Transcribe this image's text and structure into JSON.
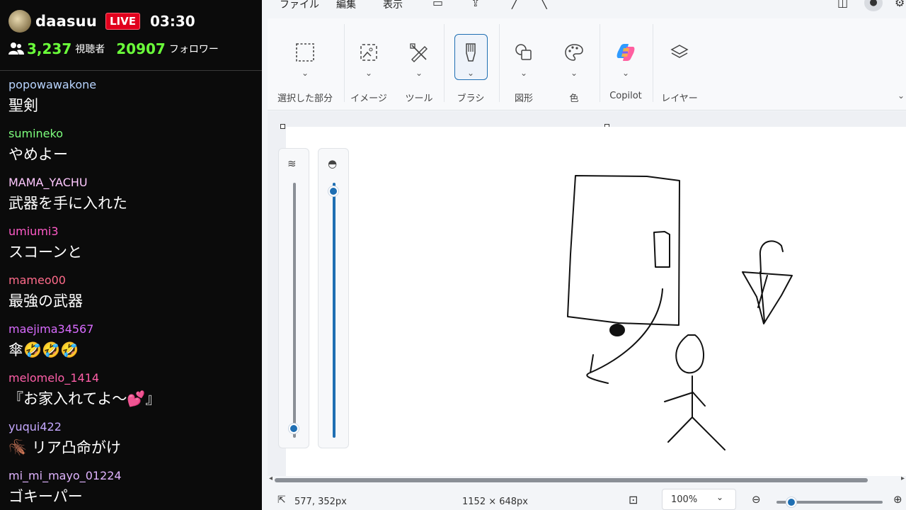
{
  "stream": {
    "streamer_name": "daasuu",
    "live_badge": "LIVE",
    "elapsed_time": "03:30",
    "viewers_count": "3,237",
    "viewers_label": "視聴者",
    "followers_count": "20907",
    "followers_label": "フォロワー"
  },
  "chat": {
    "messages": [
      {
        "user": "popowawakone",
        "user_color": "#b8d4ff",
        "text": "聖剣"
      },
      {
        "user": "sumineko",
        "user_color": "#7dff7d",
        "text": "やめよー"
      },
      {
        "user": "MAMA_YACHU",
        "user_color": "#ffc8ff",
        "text": "武器を手に入れた"
      },
      {
        "user": "umiumi3",
        "user_color": "#ff5bc8",
        "text": "スコーンと"
      },
      {
        "user": "mameo00",
        "user_color": "#ff6b8a",
        "text": "最強の武器"
      },
      {
        "user": "maejima34567",
        "user_color": "#d96bff",
        "text": "傘🤣🤣🤣"
      },
      {
        "user": "melomelo_1414",
        "user_color": "#ff5fa8",
        "text": "『お家入れてよ〜💕』"
      },
      {
        "user": "yuqui422",
        "user_color": "#c5a8ff",
        "text": "🪳 リア凸命がけ"
      },
      {
        "user": "mi_mi_mayo_01224",
        "user_color": "#e0b4ff",
        "text": "ゴキーパー"
      }
    ]
  },
  "paint": {
    "menu": {
      "file": "ファイル",
      "edit": "編集",
      "view": "表示"
    },
    "ribbon": {
      "selection": "選択した部分",
      "image": "イメージ",
      "tools": "ツール",
      "brush": "ブラシ",
      "shapes": "図形",
      "color": "色",
      "copilot": "Copilot",
      "layers": "レイヤー"
    },
    "sliders": {
      "brush_size": 0.03,
      "opacity": 0.96
    },
    "status": {
      "cursor_pos": "577, 352px",
      "canvas_size": "1152 × 648px",
      "zoom": "100%"
    },
    "accent_color": "#1f6fb3"
  }
}
